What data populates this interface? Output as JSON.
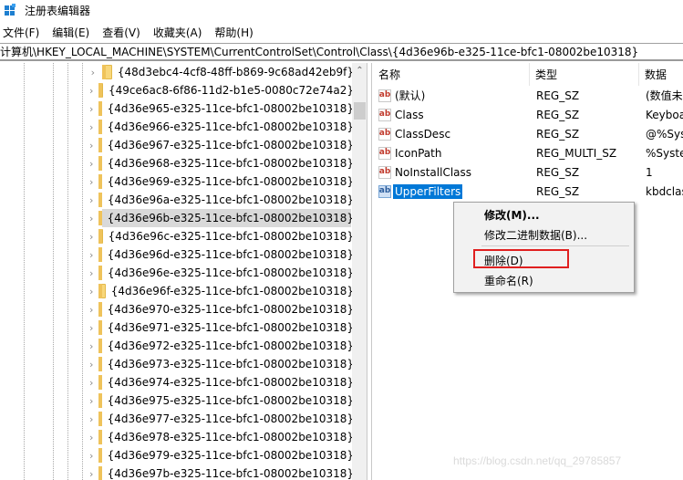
{
  "window": {
    "title": "注册表编辑器",
    "icon": "registry-editor-icon"
  },
  "menubar": {
    "items": [
      {
        "label": "文件(F)"
      },
      {
        "label": "编辑(E)"
      },
      {
        "label": "查看(V)"
      },
      {
        "label": "收藏夹(A)"
      },
      {
        "label": "帮助(H)"
      }
    ]
  },
  "address": {
    "path": "计算机\\HKEY_LOCAL_MACHINE\\SYSTEM\\CurrentControlSet\\Control\\Class\\{4d36e96b-e325-11ce-bfc1-08002be10318}"
  },
  "tree": {
    "icons": {
      "expand": "chevron-right-icon",
      "folder": "folder-icon"
    },
    "selected_index": 8,
    "items": [
      {
        "label": "{48d3ebc4-4cf8-48ff-b869-9c68ad42eb9f}"
      },
      {
        "label": "{49ce6ac8-6f86-11d2-b1e5-0080c72e74a2}"
      },
      {
        "label": "{4d36e965-e325-11ce-bfc1-08002be10318}"
      },
      {
        "label": "{4d36e966-e325-11ce-bfc1-08002be10318}"
      },
      {
        "label": "{4d36e967-e325-11ce-bfc1-08002be10318}"
      },
      {
        "label": "{4d36e968-e325-11ce-bfc1-08002be10318}"
      },
      {
        "label": "{4d36e969-e325-11ce-bfc1-08002be10318}"
      },
      {
        "label": "{4d36e96a-e325-11ce-bfc1-08002be10318}"
      },
      {
        "label": "{4d36e96b-e325-11ce-bfc1-08002be10318}"
      },
      {
        "label": "{4d36e96c-e325-11ce-bfc1-08002be10318}"
      },
      {
        "label": "{4d36e96d-e325-11ce-bfc1-08002be10318}"
      },
      {
        "label": "{4d36e96e-e325-11ce-bfc1-08002be10318}"
      },
      {
        "label": "{4d36e96f-e325-11ce-bfc1-08002be10318}"
      },
      {
        "label": "{4d36e970-e325-11ce-bfc1-08002be10318}"
      },
      {
        "label": "{4d36e971-e325-11ce-bfc1-08002be10318}"
      },
      {
        "label": "{4d36e972-e325-11ce-bfc1-08002be10318}"
      },
      {
        "label": "{4d36e973-e325-11ce-bfc1-08002be10318}"
      },
      {
        "label": "{4d36e974-e325-11ce-bfc1-08002be10318}"
      },
      {
        "label": "{4d36e975-e325-11ce-bfc1-08002be10318}"
      },
      {
        "label": "{4d36e977-e325-11ce-bfc1-08002be10318}"
      },
      {
        "label": "{4d36e978-e325-11ce-bfc1-08002be10318}"
      },
      {
        "label": "{4d36e979-e325-11ce-bfc1-08002be10318}"
      },
      {
        "label": "{4d36e97b-e325-11ce-bfc1-08002be10318}"
      }
    ]
  },
  "values": {
    "columns": {
      "name": "名称",
      "type": "类型",
      "data": "数据"
    },
    "value_icon": "string-value-icon",
    "value_icon_text": "ab",
    "selected_index": 5,
    "rows": [
      {
        "name": "(默认)",
        "type": "REG_SZ",
        "data": "(数值未"
      },
      {
        "name": "Class",
        "type": "REG_SZ",
        "data": "Keyboa"
      },
      {
        "name": "ClassDesc",
        "type": "REG_SZ",
        "data": "@%Sys"
      },
      {
        "name": "IconPath",
        "type": "REG_MULTI_SZ",
        "data": "%Syste"
      },
      {
        "name": "NoInstallClass",
        "type": "REG_SZ",
        "data": "1"
      },
      {
        "name": "UpperFilters",
        "type": "REG_SZ",
        "data": "kbdclas"
      }
    ]
  },
  "context_menu": {
    "items": [
      {
        "label": "修改(M)...",
        "bold": true
      },
      {
        "label": "修改二进制数据(B)..."
      },
      {
        "label": "删除(D)",
        "highlighted": true
      },
      {
        "label": "重命名(R)"
      }
    ],
    "highlight_color": "#e02020"
  },
  "colors": {
    "selection": "#0078d7",
    "tree_selection": "#d9d9d9"
  },
  "watermark": "https://blog.csdn.net/qq_29785857"
}
